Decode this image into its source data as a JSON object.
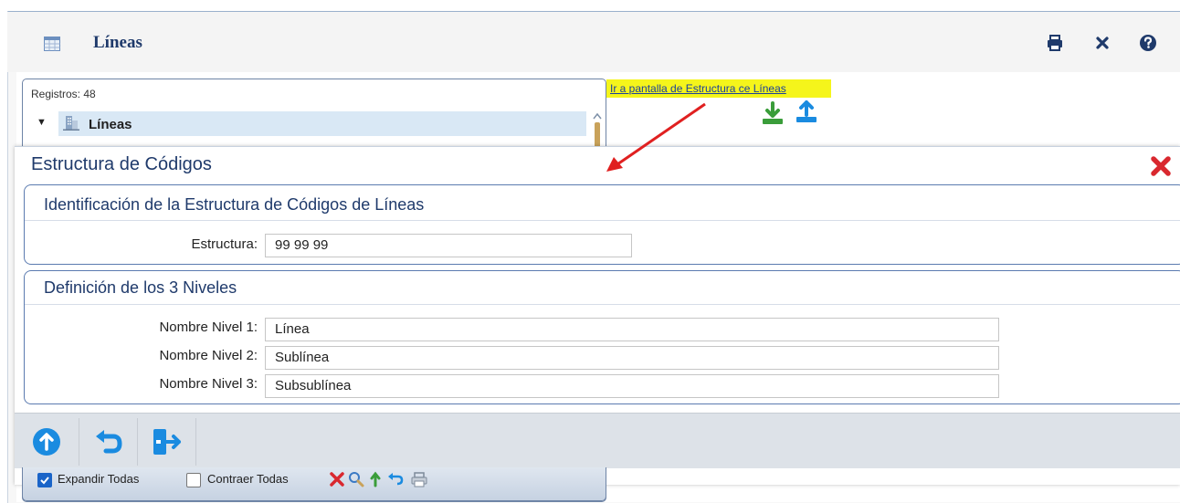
{
  "window": {
    "title": "Líneas",
    "toolbar_icons": [
      "print-icon",
      "close-icon",
      "help-icon"
    ]
  },
  "tree": {
    "records_label": "Registros: 48",
    "root_label": "Líneas",
    "footer": {
      "expand_all": "Expandir Todas",
      "collapse_all": "Contraer Todas",
      "expand_checked": true,
      "collapse_checked": false,
      "icons": [
        "delete-icon",
        "search-icon",
        "up-icon",
        "undo-icon",
        "print-icon"
      ]
    }
  },
  "link": {
    "text": "Ir a pantalla de Estructura ce Líneas"
  },
  "dialog": {
    "title": "Estructura de Códigos",
    "section1": {
      "title": "Identificación de la Estructura de Códigos de Líneas",
      "field_label": "Estructura:",
      "field_value": "99 99 99"
    },
    "section2": {
      "title": "Definición de los 3 Niveles",
      "levels": [
        {
          "label": "Nombre Nivel 1:",
          "value": "Línea"
        },
        {
          "label": "Nombre Nivel 2:",
          "value": "Sublínea"
        },
        {
          "label": "Nombre Nivel 3:",
          "value": "Subsublínea"
        }
      ]
    },
    "actions": [
      "save-up-icon",
      "undo-icon",
      "exit-icon"
    ]
  },
  "colors": {
    "accent": "#1f3a6b",
    "highlight": "#f5f51b",
    "close_red": "#d9282f",
    "action_blue": "#1a8be0"
  }
}
